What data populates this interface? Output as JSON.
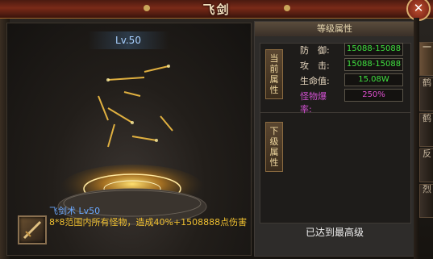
{
  "window": {
    "title": "飞剑",
    "close_symbol": "✕"
  },
  "skill": {
    "level_badge": "Lv.50",
    "name": "飞剑术 Lv50",
    "description": "8*8范围内所有怪物，造成40%+1508888点伤害"
  },
  "panel": {
    "header": "等级属性",
    "current_tag": "当前属性",
    "next_tag": "下级属性",
    "stats": [
      {
        "label": "防　御:",
        "value": "15088-15088"
      },
      {
        "label": "攻　击:",
        "value": "15088-15088"
      },
      {
        "label": "生命值:",
        "value": "15.08W"
      },
      {
        "label": "怪物爆率:",
        "value": "250%"
      }
    ],
    "max_level_text": "已达到最高级"
  },
  "side_tabs": [
    "一",
    "鹤",
    "鹤",
    "反",
    "烈"
  ],
  "colors": {
    "stat_value": "#40e040",
    "monster_rate": "#e050d0",
    "skill_name": "#6aa8ff",
    "skill_desc": "#f0c030"
  }
}
